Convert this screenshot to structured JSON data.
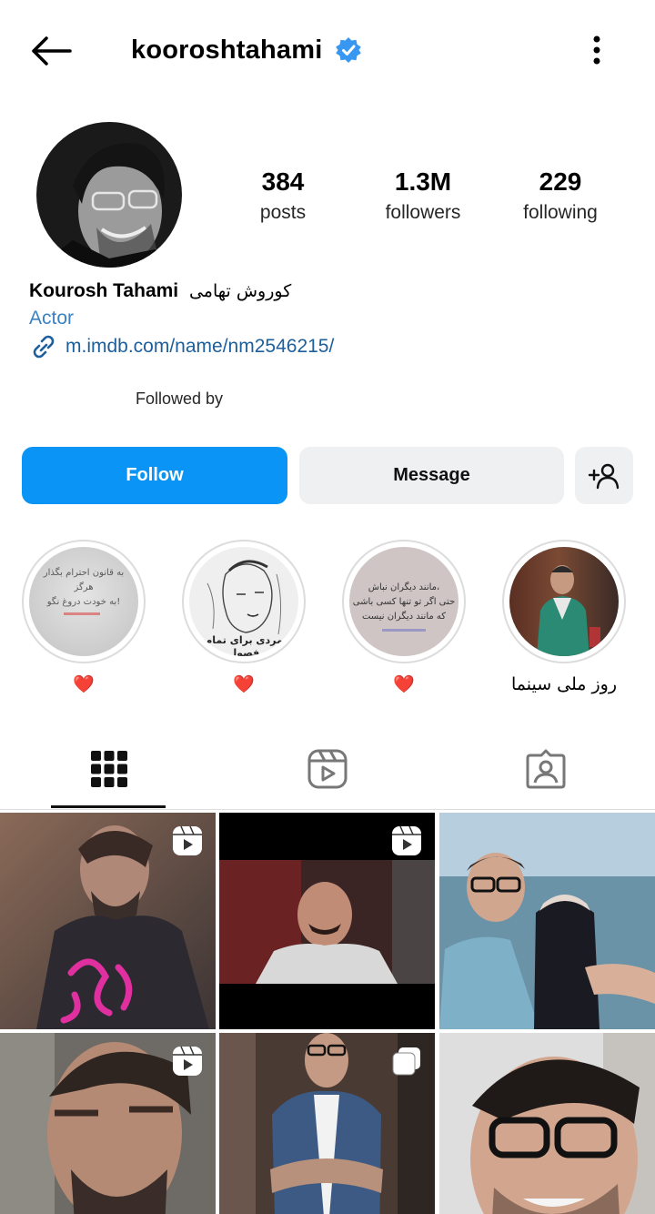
{
  "header": {
    "username": "kooroshtahami",
    "verified": true,
    "icons": {
      "back": "arrow-left-icon",
      "verified": "verified-badge-icon",
      "more": "more-vertical-icon"
    }
  },
  "profile": {
    "stats": [
      {
        "value": "384",
        "label": "posts"
      },
      {
        "value": "1.3M",
        "label": "followers"
      },
      {
        "value": "229",
        "label": "following"
      }
    ],
    "name": "Kourosh Tahami",
    "name_fa": "کوروش تهامی",
    "category": "Actor",
    "link": "m.imdb.com/name/nm2546215/",
    "followed_by": "Followed by"
  },
  "actions": {
    "follow": "Follow",
    "message": "Message",
    "add_user_icon": "add-user-icon",
    "colors": {
      "follow_bg": "#0a95f6",
      "secondary_bg": "#eff0f2"
    }
  },
  "highlights": [
    {
      "caption": "❤️",
      "lines": [
        "به قانون احترام بگذار",
        "هرگز",
        "به خودت دروغ نگو!"
      ]
    },
    {
      "caption": "❤️",
      "lines": [
        "مردی برای تمام فصول"
      ]
    },
    {
      "caption": "❤️",
      "lines": [
        "مانند دیگران نباش،",
        "حتی اگر تو تنها کسی باشی",
        "که مانند دیگران نیست"
      ]
    },
    {
      "caption": "روز ملی سینما",
      "lines": []
    }
  ],
  "tabs": [
    {
      "name": "posts-grid",
      "icon": "grid-icon",
      "active": true
    },
    {
      "name": "reels",
      "icon": "reels-icon",
      "active": false
    },
    {
      "name": "tagged",
      "icon": "tagged-user-icon",
      "active": false
    }
  ],
  "grid": [
    {
      "type": "reel"
    },
    {
      "type": "reel"
    },
    {
      "type": "photo"
    },
    {
      "type": "reel"
    },
    {
      "type": "carousel"
    },
    {
      "type": "photo"
    }
  ]
}
